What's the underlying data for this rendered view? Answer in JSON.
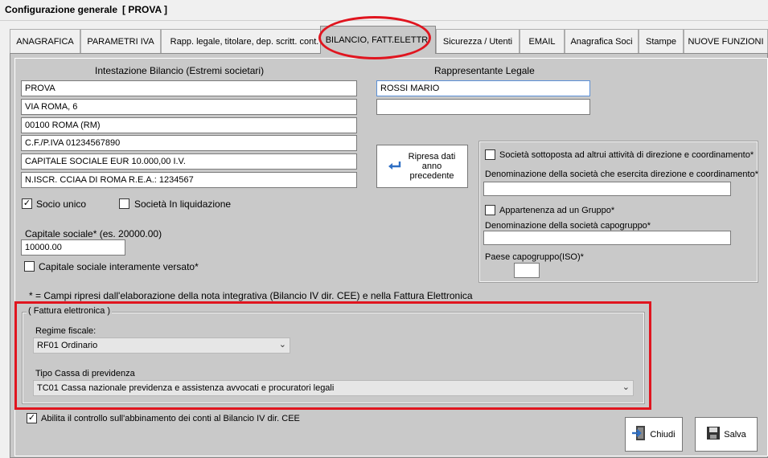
{
  "window": {
    "title": "Configurazione generale",
    "project": "[ PROVA ]"
  },
  "tabs": [
    {
      "label": "ANAGRAFICA"
    },
    {
      "label": "PARAMETRI IVA"
    },
    {
      "label": "Rapp. legale, titolare, dep. scritt. cont."
    },
    {
      "label": "BILANCIO, FATT.ELETTR."
    },
    {
      "label": "Sicurezza / Utenti"
    },
    {
      "label": "EMAIL"
    },
    {
      "label": "Anagrafica Soci"
    },
    {
      "label": "Stampe"
    },
    {
      "label": "NUOVE FUNZIONI"
    }
  ],
  "intestazione": {
    "header": "Intestazione Bilancio (Estremi societari)",
    "lines": [
      "PROVA",
      "VIA ROMA, 6",
      "00100 ROMA (RM)",
      "C.F./P.IVA 01234567890",
      "CAPITALE SOCIALE EUR 10.000,00 I.V.",
      "N.ISCR. CCIAA DI ROMA R.E.A.: 1234567"
    ]
  },
  "rappresentante": {
    "header": "Rappresentante Legale",
    "name": "ROSSI MARIO",
    "line2": ""
  },
  "ripresa_button": {
    "label": "Ripresa dati anno precedente"
  },
  "socio_unico": {
    "label": "Socio unico",
    "checked": "✓"
  },
  "liquidazione": {
    "label": "Società In liquidazione",
    "checked": ""
  },
  "capitale": {
    "label": "Capitale sociale*  (es. 20000.00)",
    "value": "10000.00",
    "versato_label": "Capitale sociale interamente versato*"
  },
  "direzione": {
    "checkbox_label": "Società sottoposta ad altrui attività di direzione e coordinamento*",
    "denominazione_label": "Denominazione della società che esercita direzione e coordinamento*",
    "denominazione_value": "",
    "gruppo_label": "Appartenenza ad un Gruppo*",
    "capogruppo_label": "Denominazione della società capogruppo*",
    "capogruppo_value": "",
    "paese_label": "Paese capogruppo(ISO)*",
    "paese_value": ""
  },
  "note": "* = Campi ripresi dall'elaborazione della nota integrativa (Bilancio IV dir. CEE) e nella Fattura Elettronica",
  "fattura": {
    "group_label": "( Fattura elettronica )",
    "regime_label": "Regime fiscale:",
    "regime_value": "RF01 Ordinario",
    "cassa_label": "Tipo Cassa di previdenza",
    "cassa_value": "TC01 Cassa nazionale previdenza e assistenza avvocati e procuratori legali"
  },
  "abilita": {
    "label": "Abilita il controllo sull'abbinamento dei conti al Bilancio IV dir. CEE",
    "checked": "✓"
  },
  "buttons": {
    "chiudi": "Chiudi",
    "salva": "Salva"
  },
  "colors": {
    "highlight": "#e0151f",
    "panel": "#c9c9c9"
  }
}
